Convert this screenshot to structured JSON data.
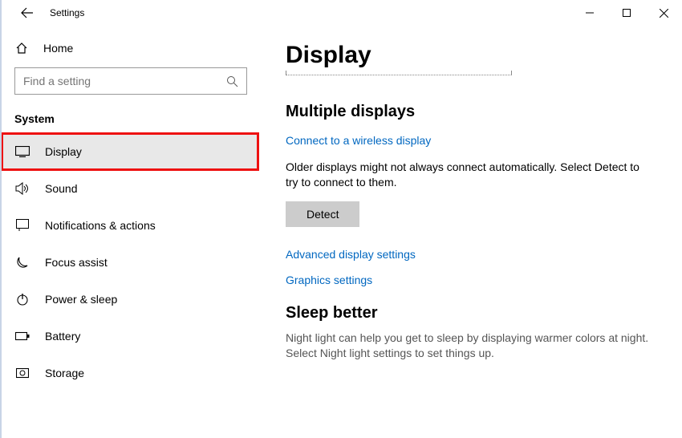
{
  "window": {
    "title": "Settings"
  },
  "sidebar": {
    "home_label": "Home",
    "search_placeholder": "Find a setting",
    "group_label": "System",
    "items": [
      {
        "label": "Display"
      },
      {
        "label": "Sound"
      },
      {
        "label": "Notifications & actions"
      },
      {
        "label": "Focus assist"
      },
      {
        "label": "Power & sleep"
      },
      {
        "label": "Battery"
      },
      {
        "label": "Storage"
      }
    ]
  },
  "main": {
    "page_title": "Display",
    "multiple_displays": {
      "heading": "Multiple displays",
      "wireless_link": "Connect to a wireless display",
      "older_text": "Older displays might not always connect automatically. Select Detect to try to connect to them.",
      "detect_button": "Detect",
      "advanced_link": "Advanced display settings",
      "graphics_link": "Graphics settings"
    },
    "sleep": {
      "heading": "Sleep better",
      "body": "Night light can help you get to sleep by displaying warmer colors at night. Select Night light settings to set things up."
    }
  }
}
